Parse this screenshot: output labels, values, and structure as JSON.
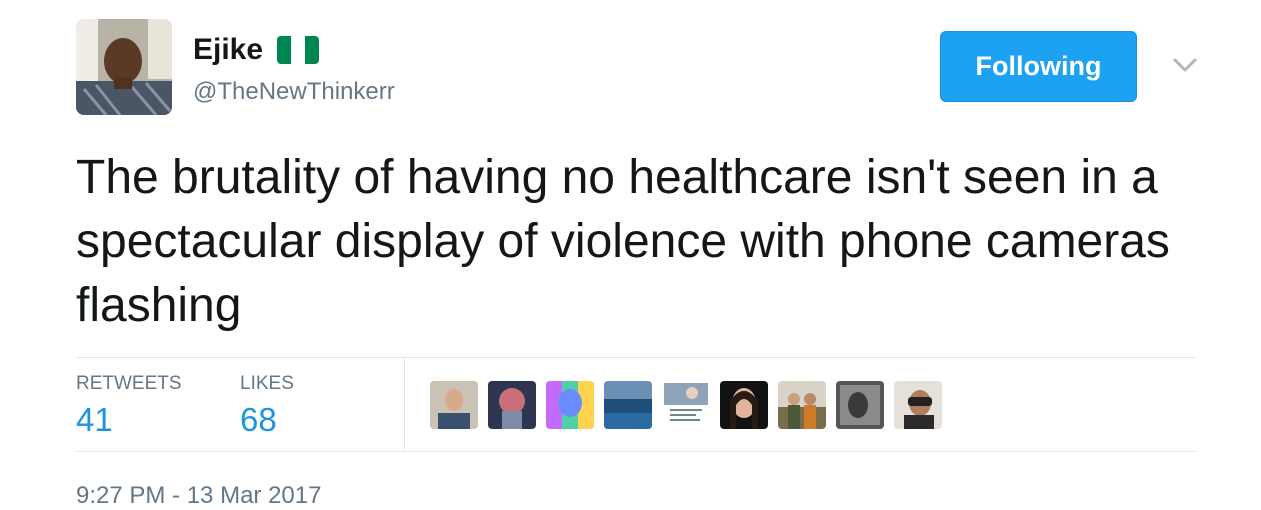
{
  "author": {
    "display_name": "Ejike",
    "handle": "@TheNewThinkerr",
    "flag_colors": [
      "#008751",
      "#ffffff",
      "#008751"
    ]
  },
  "follow_button": {
    "label": "Following",
    "color": "#1da1f2"
  },
  "tweet": {
    "text": "The brutality of having no healthcare isn't seen in a spectacular display of violence with phone cameras flashing"
  },
  "stats": {
    "retweets": {
      "label": "RETWEETS",
      "value": "41"
    },
    "likes": {
      "label": "LIKES",
      "value": "68"
    }
  },
  "likers": [
    {
      "name": "liker-avatar-1"
    },
    {
      "name": "liker-avatar-2"
    },
    {
      "name": "liker-avatar-3"
    },
    {
      "name": "liker-avatar-4"
    },
    {
      "name": "liker-avatar-5"
    },
    {
      "name": "liker-avatar-6"
    },
    {
      "name": "liker-avatar-7"
    },
    {
      "name": "liker-avatar-8"
    },
    {
      "name": "liker-avatar-9"
    }
  ],
  "timestamp": "9:27 PM - 13 Mar 2017",
  "colors": {
    "accent": "#1da1f2",
    "link_blue": "#1b95e0",
    "muted": "#657786",
    "divider": "#e1e8ed"
  }
}
